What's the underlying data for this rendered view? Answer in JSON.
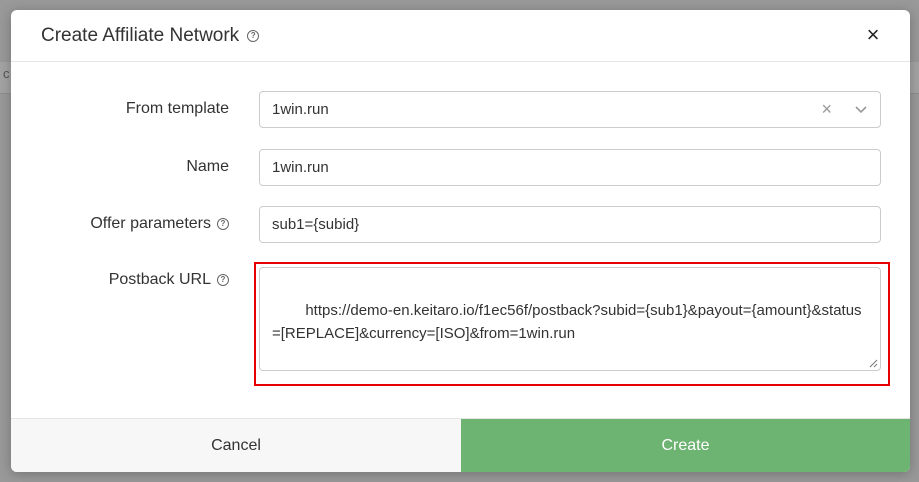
{
  "modal": {
    "title": "Create Affiliate Network",
    "help_icon": "question-circle-icon",
    "close_icon": "close-icon"
  },
  "form": {
    "template": {
      "label": "From template",
      "value": "1win.run"
    },
    "name": {
      "label": "Name",
      "value": "1win.run"
    },
    "offer_parameters": {
      "label": "Offer parameters",
      "value": "sub1={subid}"
    },
    "postback_url": {
      "label": "Postback URL",
      "value": "https://demo-en.keitaro.io/f1ec56f/postback?subid={sub1}&payout={amount}&status=[REPLACE]&currency=[ISO]&from=1win.run"
    }
  },
  "footer": {
    "cancel_label": "Cancel",
    "create_label": "Create"
  },
  "colors": {
    "create_button": "#6db372",
    "highlight_border": "#e60000",
    "overlay": "#999999"
  },
  "background": {
    "visible_letter": "c"
  }
}
